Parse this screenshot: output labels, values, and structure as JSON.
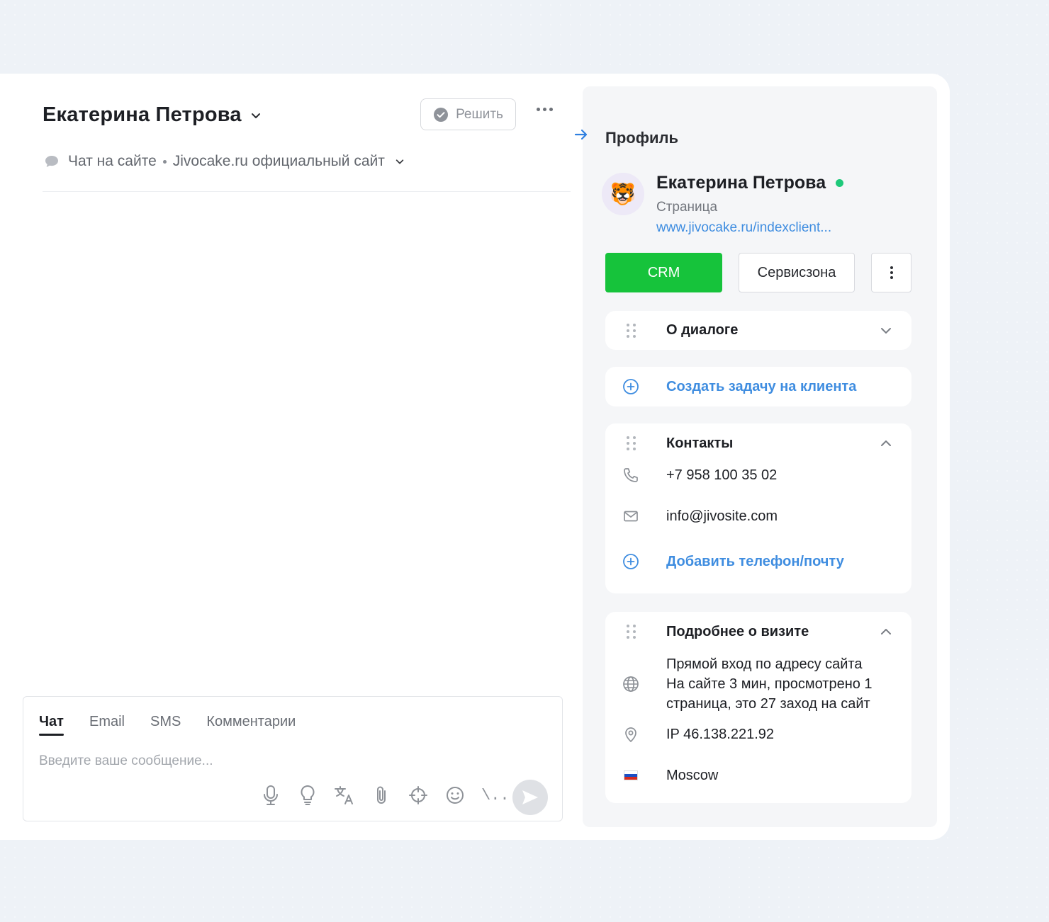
{
  "chat": {
    "client_name": "Екатерина Петрова",
    "resolve_label": "Решить",
    "channel": "Чат на сайте",
    "site": "Jivocake.ru официальный сайт"
  },
  "composer": {
    "tabs": [
      {
        "label": "Чат",
        "active": true
      },
      {
        "label": "Email",
        "active": false
      },
      {
        "label": "SMS",
        "active": false
      },
      {
        "label": "Комментарии",
        "active": false
      }
    ],
    "placeholder": "Введите ваше сообщение...",
    "tools": [
      "microphone-icon",
      "lightbulb-icon",
      "translate-icon",
      "paperclip-icon",
      "crosshair-icon",
      "smile-icon"
    ],
    "shortcut_label": "\\..",
    "send_icon": "send-icon"
  },
  "profile": {
    "title": "Профиль",
    "avatar_emoji": "🐯",
    "name": "Екатерина Петрова",
    "status_color": "#1ec97a",
    "page_label": "Страница",
    "page_link": "www.jivocake.ru/indexclient...",
    "btn_crm": "CRM",
    "btn_service": "Сервисзона",
    "accent_green": "#16c33b",
    "link_blue": "#3f8de0"
  },
  "sections": {
    "dialog": {
      "title": "О диалоге"
    },
    "task": {
      "label": "Создать задачу на клиента"
    },
    "contacts": {
      "title": "Контакты",
      "phone": "+7 958 100 35 02",
      "email": "info@jivosite.com",
      "add_label": "Добавить телефон/почту"
    },
    "visit": {
      "title": "Подробнее о визите",
      "source_line1": "Прямой вход по адресу сайта",
      "source_line2": "На сайте 3 мин, просмотрено 1",
      "source_line3": "страница, это 27 заход на сайт",
      "ip": "IP 46.138.221.92",
      "city": "Moscow"
    }
  }
}
